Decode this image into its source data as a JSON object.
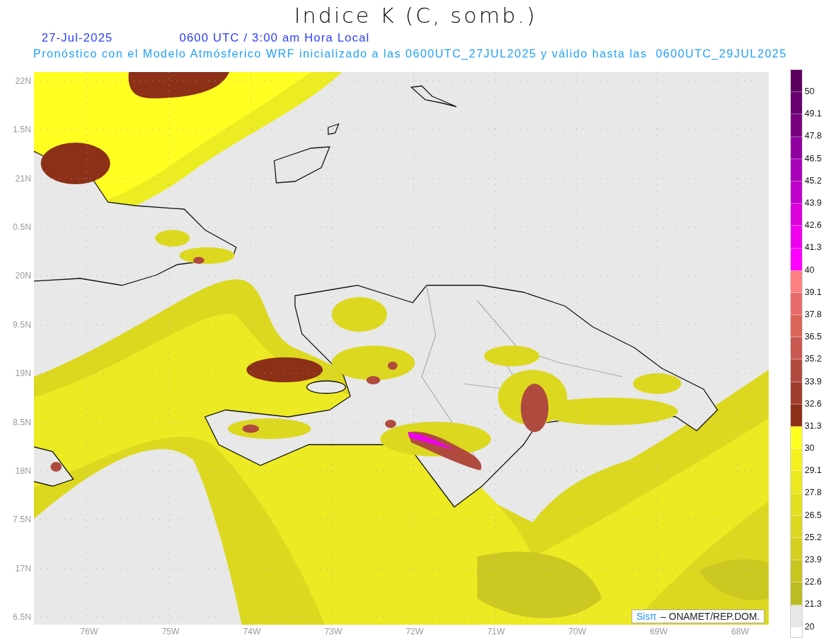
{
  "title": "Indice K (C, somb.)",
  "date": "27-Jul-2025",
  "time": "0600 UTC / 3:00 am Hora Local",
  "description": "Pronóstico con el Modelo Atmósferico WRF inicializado a las 0600UTC_27JUL2025 y válido hasta las  0600UTC_29JUL2025",
  "lat_labels": [
    "22N",
    "1.5N",
    "21N",
    "0.5N",
    "20N",
    "9.5N",
    "19N",
    "8.5N",
    "18N",
    "7.5N",
    "17N",
    "6.5N"
  ],
  "lon_labels": [
    "76W",
    "75W",
    "74W",
    "73W",
    "72W",
    "71W",
    "70W",
    "69W",
    "68W"
  ],
  "colorbar": {
    "segments": [
      {
        "color": "#5c0060"
      },
      {
        "color": "#680070"
      },
      {
        "color": "#780080"
      },
      {
        "color": "#9000a0"
      },
      {
        "color": "#a800b8"
      },
      {
        "color": "#c000cc"
      },
      {
        "color": "#dc00dc"
      },
      {
        "color": "#ee00ee"
      },
      {
        "color": "#ff00ff"
      },
      {
        "color": "#ff8080"
      },
      {
        "color": "#e86a6a"
      },
      {
        "color": "#dc6458"
      },
      {
        "color": "#c85850"
      },
      {
        "color": "#b04a3e"
      },
      {
        "color": "#a03c2c"
      },
      {
        "color": "#8c3018"
      },
      {
        "color": "#ffff20"
      },
      {
        "color": "#f4f020"
      },
      {
        "color": "#ece820"
      },
      {
        "color": "#e4e020"
      },
      {
        "color": "#dcd820"
      },
      {
        "color": "#d4d020"
      },
      {
        "color": "#c8c420"
      },
      {
        "color": "#bcbc20"
      },
      {
        "color": "#e8e8e8"
      }
    ],
    "labels": [
      "50",
      "49.1",
      "47.8",
      "46.5",
      "45.2",
      "43.9",
      "42.6",
      "41.3",
      "40",
      "39.1",
      "37.8",
      "36.5",
      "35.2",
      "33.9",
      "32.6",
      "31.3",
      "30",
      "29.1",
      "27.8",
      "26.5",
      "25.2",
      "23.9",
      "22.6",
      "21.3",
      "20"
    ]
  },
  "credit": {
    "logo": "Sisπ",
    "text": "– ONAMET/REP.DOM."
  }
}
